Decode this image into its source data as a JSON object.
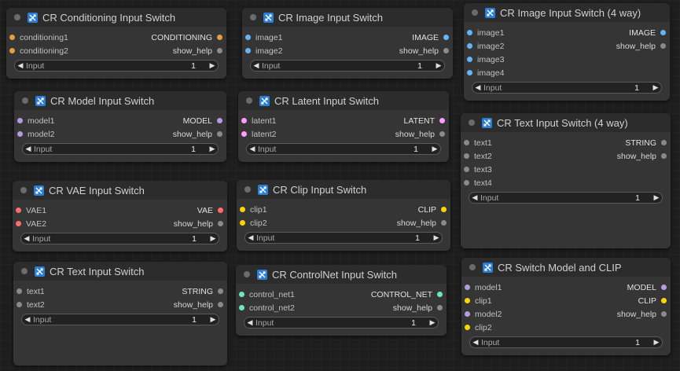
{
  "colors": {
    "conditioning": "#e49e3c",
    "image": "#64b5f6",
    "model": "#b39ddb",
    "latent": "#ff9cf9",
    "vae": "#ff6e6e",
    "clip": "#ffd500",
    "string": "#8a8a8a",
    "control_net": "#6ee7b7",
    "help": "#8a8a8a"
  },
  "nodes": {
    "conditioning": {
      "title": "CR Conditioning Input Switch",
      "inputs": [
        "conditioning1",
        "conditioning2"
      ],
      "outputs": [
        "CONDITIONING",
        "show_help"
      ],
      "widget": {
        "label": "Input",
        "value": "1"
      }
    },
    "image": {
      "title": "CR Image Input Switch",
      "inputs": [
        "image1",
        "image2"
      ],
      "outputs": [
        "IMAGE",
        "show_help"
      ],
      "widget": {
        "label": "Input",
        "value": "1"
      }
    },
    "image4": {
      "title": "CR Image Input Switch (4 way)",
      "inputs": [
        "image1",
        "image2",
        "image3",
        "image4"
      ],
      "outputs": [
        "IMAGE",
        "show_help"
      ],
      "widget": {
        "label": "Input",
        "value": "1"
      }
    },
    "model": {
      "title": "CR Model Input Switch",
      "inputs": [
        "model1",
        "model2"
      ],
      "outputs": [
        "MODEL",
        "show_help"
      ],
      "widget": {
        "label": "Input",
        "value": "1"
      }
    },
    "latent": {
      "title": "CR Latent Input Switch",
      "inputs": [
        "latent1",
        "latent2"
      ],
      "outputs": [
        "LATENT",
        "show_help"
      ],
      "widget": {
        "label": "Input",
        "value": "1"
      }
    },
    "text4": {
      "title": "CR Text Input Switch (4 way)",
      "inputs": [
        "text1",
        "text2",
        "text3",
        "text4"
      ],
      "outputs": [
        "STRING",
        "show_help"
      ],
      "widget": {
        "label": "Input",
        "value": "1"
      }
    },
    "vae": {
      "title": "CR VAE Input Switch",
      "inputs": [
        "VAE1",
        "VAE2"
      ],
      "outputs": [
        "VAE",
        "show_help"
      ],
      "widget": {
        "label": "Input",
        "value": "1"
      }
    },
    "clip": {
      "title": "CR Clip Input Switch",
      "inputs": [
        "clip1",
        "clip2"
      ],
      "outputs": [
        "CLIP",
        "show_help"
      ],
      "widget": {
        "label": "Input",
        "value": "1"
      }
    },
    "text": {
      "title": "CR Text Input Switch",
      "inputs": [
        "text1",
        "text2"
      ],
      "outputs": [
        "STRING",
        "show_help"
      ],
      "widget": {
        "label": "Input",
        "value": "1"
      }
    },
    "controlnet": {
      "title": "CR ControlNet Input Switch",
      "inputs": [
        "control_net1",
        "control_net2"
      ],
      "outputs": [
        "CONTROL_NET",
        "show_help"
      ],
      "widget": {
        "label": "Input",
        "value": "1"
      }
    },
    "modelclip": {
      "title": "CR Switch Model and CLIP",
      "inputs": [
        "model1",
        "clip1",
        "model2",
        "clip2"
      ],
      "outputs": [
        "MODEL",
        "CLIP",
        "show_help"
      ],
      "widget": {
        "label": "Input",
        "value": "1"
      }
    }
  }
}
